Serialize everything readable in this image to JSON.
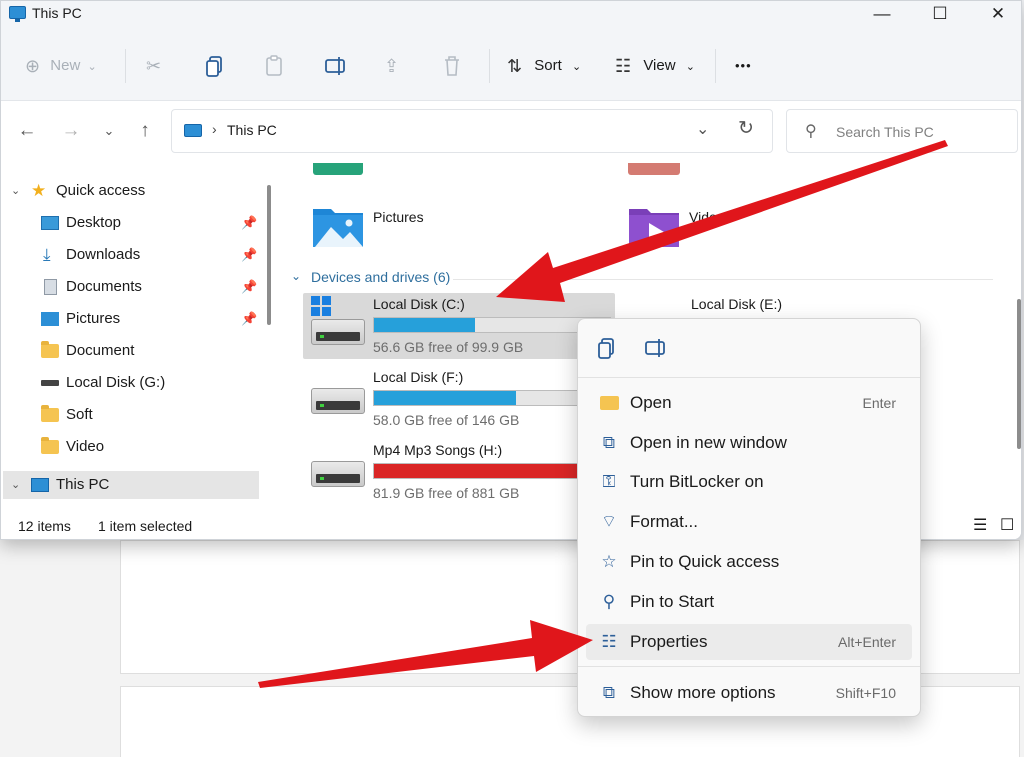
{
  "window": {
    "title": "This PC",
    "controls": {
      "minimize": "—",
      "maximize": "☐",
      "close": "✕"
    }
  },
  "toolbar": {
    "new": "New",
    "sort": "Sort",
    "view": "View",
    "more": "•••"
  },
  "address": {
    "path": "This PC",
    "search_placeholder": "Search This PC"
  },
  "nav": {
    "items": [
      {
        "label": "Quick access",
        "icon": "star-icon"
      },
      {
        "label": "Desktop",
        "icon": "desktop-icon",
        "pinned": true
      },
      {
        "label": "Downloads",
        "icon": "download-icon",
        "pinned": true
      },
      {
        "label": "Documents",
        "icon": "document-icon",
        "pinned": true
      },
      {
        "label": "Pictures",
        "icon": "pictures-icon",
        "pinned": true
      },
      {
        "label": "Document",
        "icon": "folder-icon"
      },
      {
        "label": "Local Disk (G:)",
        "icon": "drive-icon"
      },
      {
        "label": "Soft",
        "icon": "folder-icon"
      },
      {
        "label": "Video",
        "icon": "folder-icon"
      },
      {
        "label": "This PC",
        "icon": "pc-icon",
        "selected": true
      }
    ]
  },
  "content": {
    "folders": [
      {
        "label": "Pictures",
        "icon": "pictures-folder-icon"
      },
      {
        "label": "Videos",
        "icon": "videos-folder-icon"
      }
    ],
    "section_title": "Devices and drives (6)",
    "drives": [
      {
        "name": "Local Disk (C:)",
        "free": "56.6 GB free of 99.9 GB",
        "used_fraction": 0.43,
        "bar_color": "#26a0da",
        "selected": true
      },
      {
        "name": "Local Disk (E:)"
      },
      {
        "name": "Local Disk (F:)",
        "free": "58.0 GB free of 146 GB",
        "used_fraction": 0.6,
        "bar_color": "#26a0da"
      },
      {
        "name": "Mp4 Mp3 Songs (H:)",
        "free": "81.9 GB free of 881 GB",
        "used_fraction": 0.91,
        "bar_color": "#da2626"
      }
    ]
  },
  "status": {
    "items": "12 items",
    "selected": "1 item selected"
  },
  "context_menu": {
    "items": [
      {
        "label": "Open",
        "shortcut": "Enter",
        "icon": "folder-open-icon"
      },
      {
        "label": "Open in new window",
        "shortcut": "",
        "icon": "open-new-window-icon"
      },
      {
        "label": "Turn BitLocker on",
        "shortcut": "",
        "icon": "bitlocker-key-icon"
      },
      {
        "label": "Format...",
        "shortcut": "",
        "icon": "format-icon"
      },
      {
        "label": "Pin to Quick access",
        "shortcut": "",
        "icon": "star-outline-icon"
      },
      {
        "label": "Pin to Start",
        "shortcut": "",
        "icon": "pin-icon"
      },
      {
        "label": "Properties",
        "shortcut": "Alt+Enter",
        "icon": "properties-icon",
        "highlighted": true
      },
      {
        "label": "Show more options",
        "shortcut": "Shift+F10",
        "icon": "show-more-icon"
      }
    ]
  },
  "annotations": {
    "arrow_color": "#e0161b"
  }
}
